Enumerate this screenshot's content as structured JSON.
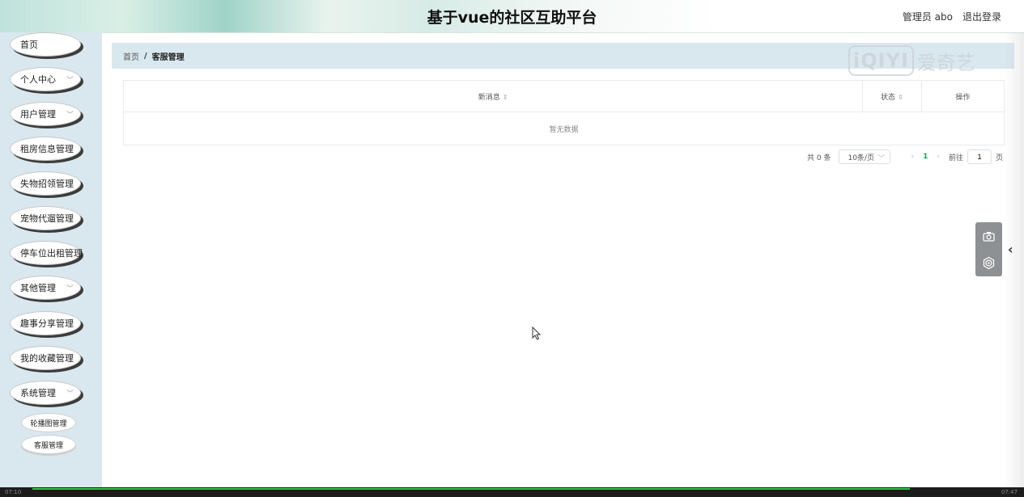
{
  "header": {
    "title": "基于vue的社区互助平台",
    "user": "管理员 abo",
    "logout": "退出登录"
  },
  "sidebar": {
    "items": [
      {
        "label": "首页"
      },
      {
        "label": "个人中心"
      },
      {
        "label": "用户管理"
      },
      {
        "label": "租房信息管理"
      },
      {
        "label": "失物招领管理"
      },
      {
        "label": "宠物代遛管理"
      },
      {
        "label": "停车位出租管理"
      },
      {
        "label": "其他管理"
      },
      {
        "label": "趣事分享管理"
      },
      {
        "label": "我的收藏管理"
      },
      {
        "label": "系统管理"
      }
    ],
    "subitems": [
      {
        "label": "轮播图管理"
      },
      {
        "label": "客服管理"
      }
    ]
  },
  "breadcrumb": {
    "home": "首页",
    "separator": "/",
    "current": "客服管理"
  },
  "watermark": {
    "logo": "iQIYI",
    "text": "爱奇艺"
  },
  "table": {
    "columns": [
      "新消息",
      "状态",
      "操作"
    ],
    "empty_text": "暂无数据"
  },
  "pagination": {
    "total": "共 0 条",
    "page_size": "10条/页",
    "prev": "‹",
    "current_page": "1",
    "next": "›",
    "goto_label": "前往",
    "goto_value": "1",
    "page_suffix": "页"
  },
  "player": {
    "elapsed": "07:10",
    "duration": "07:47",
    "progress_fraction": 0.98
  },
  "colors": {
    "accent": "#19a35b",
    "sidebar_bg": "#d9e8ee",
    "progress": "#26c948"
  }
}
